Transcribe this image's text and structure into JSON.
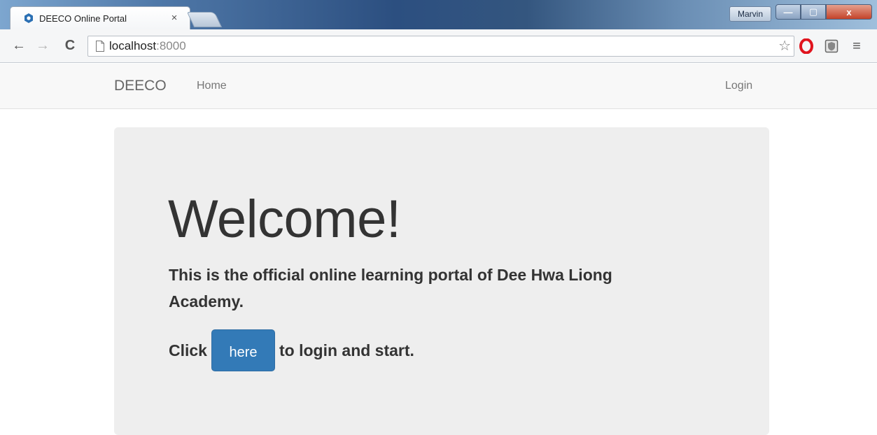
{
  "browser": {
    "tab": {
      "title": "DEECO Online Portal",
      "favicon": "deeco-logo-icon",
      "close_glyph": "×"
    },
    "user_badge": "Marvin",
    "window_controls": {
      "minimize": "—",
      "maximize": "▢",
      "close": "x"
    },
    "nav": {
      "back": "←",
      "forward": "→",
      "reload": "C"
    },
    "url": {
      "host": "localhost",
      "port": ":8000"
    },
    "icons": [
      "page-icon",
      "star-icon",
      "opera-icon",
      "shield-extension-icon",
      "menu-icon"
    ]
  },
  "navbar": {
    "brand": "DEECO",
    "links": {
      "home": "Home",
      "login": "Login"
    }
  },
  "jumbotron": {
    "heading": "Welcome!",
    "lead": "This is the official online learning portal of Dee Hwa Liong Academy.",
    "cta_before": "Click",
    "cta_button": "here",
    "cta_after": "to login and start."
  },
  "colors": {
    "primary_button": "#337ab7",
    "jumbotron_bg": "#eeeeee",
    "navbar_bg": "#f8f8f8",
    "text": "#333333"
  }
}
